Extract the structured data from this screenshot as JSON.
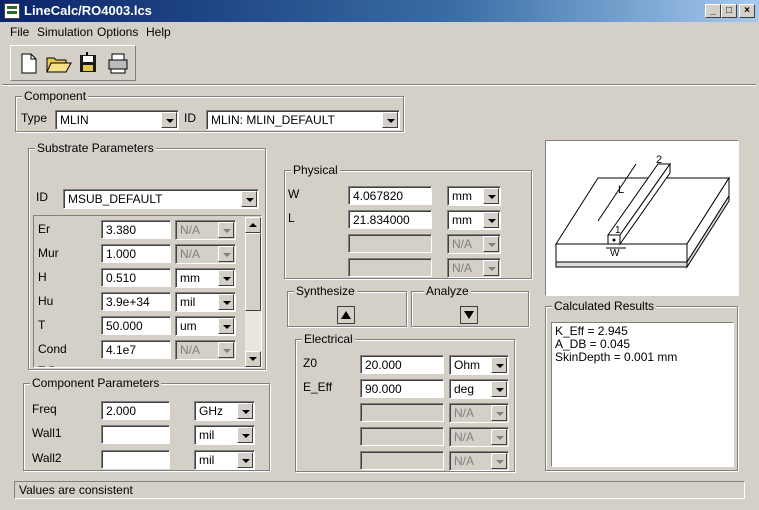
{
  "window": {
    "title": "LineCalc/RO4003.lcs"
  },
  "menu": [
    "File",
    "Simulation",
    "Options",
    "Help"
  ],
  "toolbar": [
    "new-file-icon",
    "open-folder-icon",
    "save-icon",
    "print-icon"
  ],
  "component": {
    "label": "Component",
    "type_label": "Type",
    "type_value": "MLIN",
    "id_label": "ID",
    "id_value": "MLIN: MLIN_DEFAULT"
  },
  "substrate": {
    "label": "Substrate Parameters",
    "id_label": "ID",
    "id_value": "MSUB_DEFAULT",
    "rows": [
      {
        "name": "Er",
        "value": "3.380",
        "unit": "N/A",
        "unit_enabled": false
      },
      {
        "name": "Mur",
        "value": "1.000",
        "unit": "N/A",
        "unit_enabled": false
      },
      {
        "name": "H",
        "value": "0.510",
        "unit": "mm",
        "unit_enabled": true
      },
      {
        "name": "Hu",
        "value": "3.9e+34",
        "unit": "mil",
        "unit_enabled": true
      },
      {
        "name": "T",
        "value": "50.000",
        "unit": "um",
        "unit_enabled": true
      },
      {
        "name": "Cond",
        "value": "4.1e7",
        "unit": "N/A",
        "unit_enabled": false
      }
    ]
  },
  "component_params": {
    "label": "Component Parameters",
    "rows": [
      {
        "name": "Freq",
        "value": "2.000",
        "unit": "GHz"
      },
      {
        "name": "Wall1",
        "value": "",
        "unit": "mil"
      },
      {
        "name": "Wall2",
        "value": "",
        "unit": "mil"
      }
    ]
  },
  "physical": {
    "label": "Physical",
    "rows": [
      {
        "name": "W",
        "value": "4.067820",
        "unit": "mm",
        "enabled": true
      },
      {
        "name": "L",
        "value": "21.834000",
        "unit": "mm",
        "enabled": true
      },
      {
        "name": "",
        "value": "",
        "unit": "N/A",
        "enabled": false
      },
      {
        "name": "",
        "value": "",
        "unit": "N/A",
        "enabled": false
      }
    ]
  },
  "synthesize": {
    "label": "Synthesize"
  },
  "analyze": {
    "label": "Analyze"
  },
  "electrical": {
    "label": "Electrical",
    "rows": [
      {
        "name": "Z0",
        "value": "20.000",
        "unit": "Ohm",
        "enabled": true
      },
      {
        "name": "E_Eff",
        "value": "90.000",
        "unit": "deg",
        "enabled": true
      },
      {
        "name": "",
        "value": "",
        "unit": "N/A",
        "enabled": false
      },
      {
        "name": "",
        "value": "",
        "unit": "N/A",
        "enabled": false
      },
      {
        "name": "",
        "value": "",
        "unit": "N/A",
        "enabled": false
      }
    ]
  },
  "diagram": {
    "labels": [
      "2",
      "L",
      "1",
      "W"
    ]
  },
  "results": {
    "label": "Calculated Results",
    "lines": [
      "K_Eff = 2.945",
      "A_DB = 0.045",
      "SkinDepth = 0.001 mm"
    ]
  },
  "status": {
    "text": "Values are consistent"
  }
}
